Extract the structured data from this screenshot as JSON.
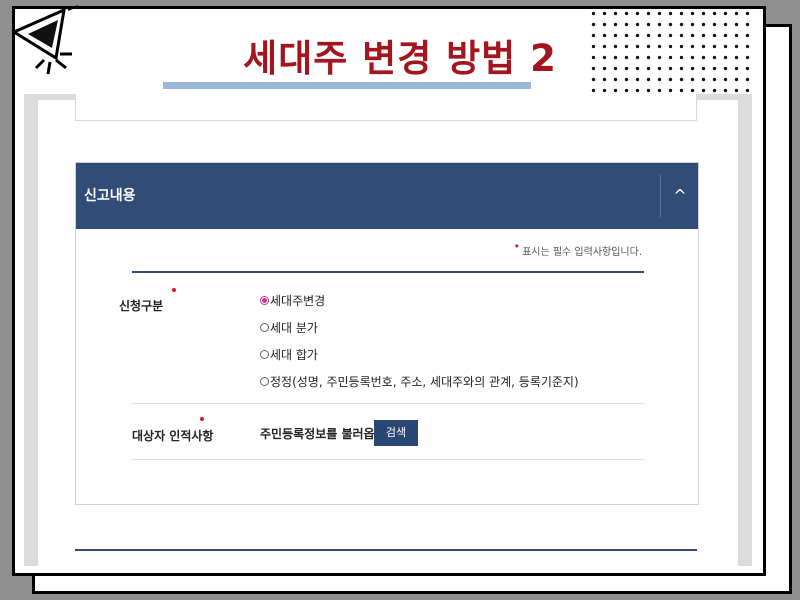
{
  "slide": {
    "title": "세대주 변경 방법 2"
  },
  "panel": {
    "title": "신고내용",
    "collapse_icon": "^",
    "required_note": "표시는 필수 입력사항입니다.",
    "required_mark": "•"
  },
  "form": {
    "request_type": {
      "label": "신청구분",
      "selected": "세대주변경",
      "options": [
        "세대주변경",
        "세대 분가",
        "세대 합가",
        "정정(성명, 주민등록번호, 주소, 세대주와의 관계, 등록기준지)"
      ]
    },
    "target_person": {
      "label": "대상자 인적사항",
      "lookup_text": "주민등록정보를 불러옵니다.",
      "search_label": "검색"
    }
  },
  "colors": {
    "title_red": "#a4161f",
    "header_navy": "#314c77",
    "button_navy": "#2a4675",
    "required_red": "#e0142a",
    "radio_checked": "#d2338f"
  }
}
